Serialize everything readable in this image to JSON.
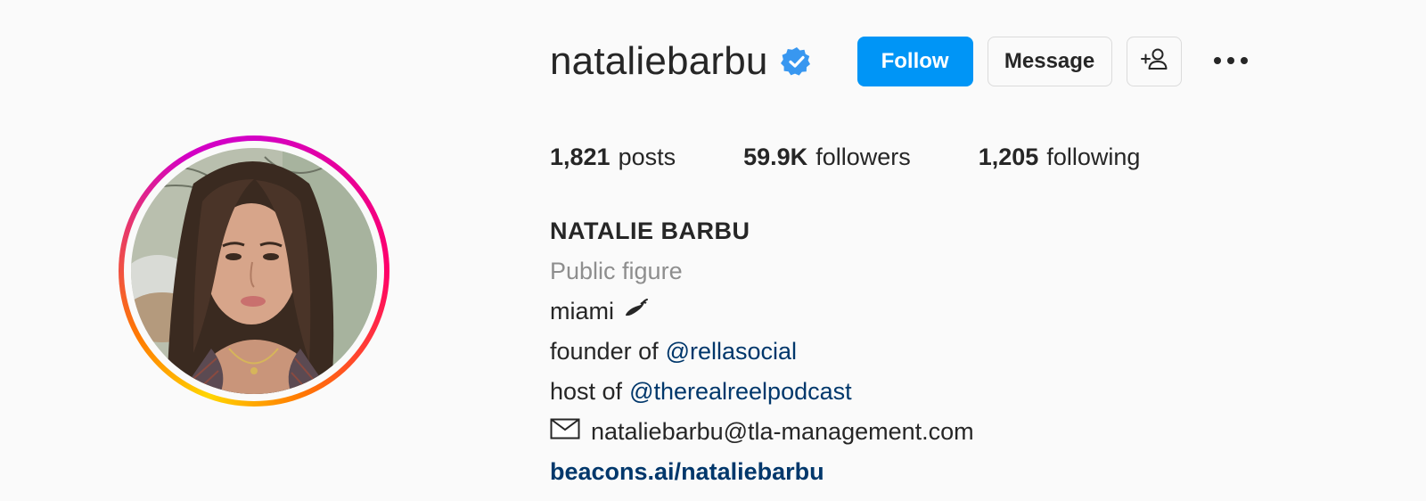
{
  "profile": {
    "username": "nataliebarbu",
    "verified": true,
    "verified_color": "#3897f0",
    "avatar_ring_colors": [
      "#d300c5",
      "#ff0069",
      "#ff7a00",
      "#ffd600"
    ]
  },
  "actions": {
    "follow_label": "Follow",
    "message_label": "Message",
    "follow_color": "#0095f6",
    "suggest_icon": "add-person-icon",
    "more_icon": "more-horizontal-icon"
  },
  "stats": {
    "posts_value": "1,821",
    "posts_label": "posts",
    "followers_value": "59.9K",
    "followers_label": "followers",
    "following_value": "1,205",
    "following_label": "following"
  },
  "bio": {
    "full_name": "NATALIE BARBU",
    "category": "Public figure",
    "line1_text": "miami",
    "line1_icon": "hot-pepper-icon",
    "line2_prefix": "founder of",
    "line2_mention": "@rellasocial",
    "line3_prefix": "host of",
    "line3_mention": "@therealreelpodcast",
    "email_icon": "envelope-icon",
    "email": "nataliebarbu@tla-management.com",
    "website": "beacons.ai/nataliebarbu",
    "link_color": "#00376b"
  }
}
